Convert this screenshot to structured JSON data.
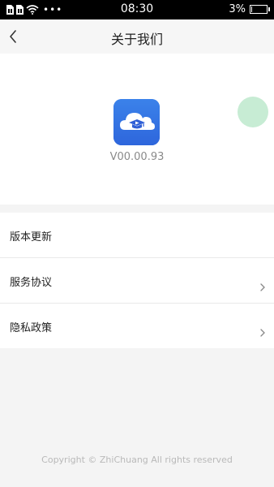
{
  "status_bar": {
    "time": "08:30",
    "battery_percent": "3%",
    "battery_level": 0.03,
    "more_indicator": "•••",
    "icons": [
      "sim-card-icon",
      "sim-card-icon",
      "wifi-icon",
      "battery-icon"
    ]
  },
  "nav": {
    "title": "关于我们",
    "back_icon": "chevron-left-icon"
  },
  "app": {
    "version": "V00.00.93",
    "logo_icon": "cloud-graduation-cap-icon"
  },
  "menu": {
    "items": [
      {
        "label": "版本更新",
        "has_arrow": false
      },
      {
        "label": "服务协议",
        "has_arrow": true
      },
      {
        "label": "隐私政策",
        "has_arrow": true
      }
    ]
  },
  "footer": {
    "copyright": "Copyright © ZhiChuang All rights reserved"
  },
  "colors": {
    "brand_blue": "#2f6fe0",
    "float_ball": "#c7ecd4",
    "page_bg": "#f4f4f4"
  }
}
